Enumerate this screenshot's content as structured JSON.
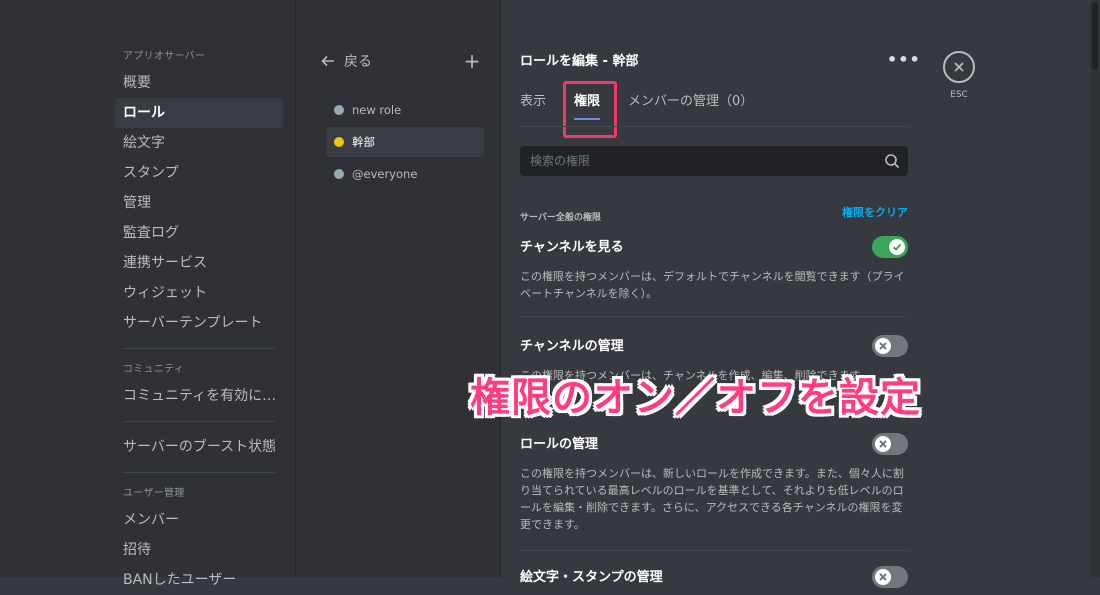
{
  "window": {
    "dot_colors": [
      "#ff5f57",
      "#febc2e",
      "#28c840"
    ]
  },
  "sidebar": {
    "sections": [
      {
        "header": "アプリオサーバー",
        "items": [
          "概要",
          "ロール",
          "絵文字",
          "スタンプ",
          "管理",
          "監査ログ",
          "連携サービス",
          "ウィジェット",
          "サーバーテンプレート"
        ]
      },
      {
        "header": "コミュニティ",
        "items": [
          "コミュニティを有効に…"
        ]
      },
      {
        "header": "",
        "items": [
          "サーバーのブースト状態"
        ]
      },
      {
        "header": "ユーザー管理",
        "items": [
          "メンバー",
          "招待",
          "BANしたユーザー"
        ]
      }
    ],
    "active_item": "ロール"
  },
  "roles": {
    "back_label": "戻る",
    "items": [
      {
        "name": "new role",
        "color": "#99aab5"
      },
      {
        "name": "幹部",
        "color": "#f1c40f"
      },
      {
        "name": "@everyone",
        "color": "#99aab5"
      }
    ],
    "active_index": 1
  },
  "main": {
    "title": "ロールを編集 - 幹部",
    "tabs": [
      "表示",
      "権限",
      "メンバーの管理（0）"
    ],
    "active_tab": 1,
    "search_placeholder": "検索の権限",
    "section_label": "サーバー全般の権限",
    "clear_label": "権限をクリア",
    "permissions": [
      {
        "name": "チャンネルを見る",
        "desc": "この権限を持つメンバーは、デフォルトでチャンネルを閲覧できます（プライベートチャンネルを除く）。",
        "enabled": true
      },
      {
        "name": "チャンネルの管理",
        "desc": "この権限を持つメンバーは、チャンネルを作成、編集、削除できます。",
        "enabled": false
      },
      {
        "name": "ロールの管理",
        "desc": "この権限を持つメンバーは、新しいロールを作成できます。また、個々人に割り当てられている最高レベルのロールを基準として、それよりも低レベルのロールを編集・削除できます。さらに、アクセスできる各チャンネルの権限を変更できます。",
        "enabled": false
      },
      {
        "name": "絵文字・スタンプの管理",
        "desc": "",
        "enabled": false
      }
    ]
  },
  "close": {
    "label": "ESC"
  },
  "overlay": {
    "text": "権限のオン／オフを設定",
    "color": "#ff3d7f"
  }
}
